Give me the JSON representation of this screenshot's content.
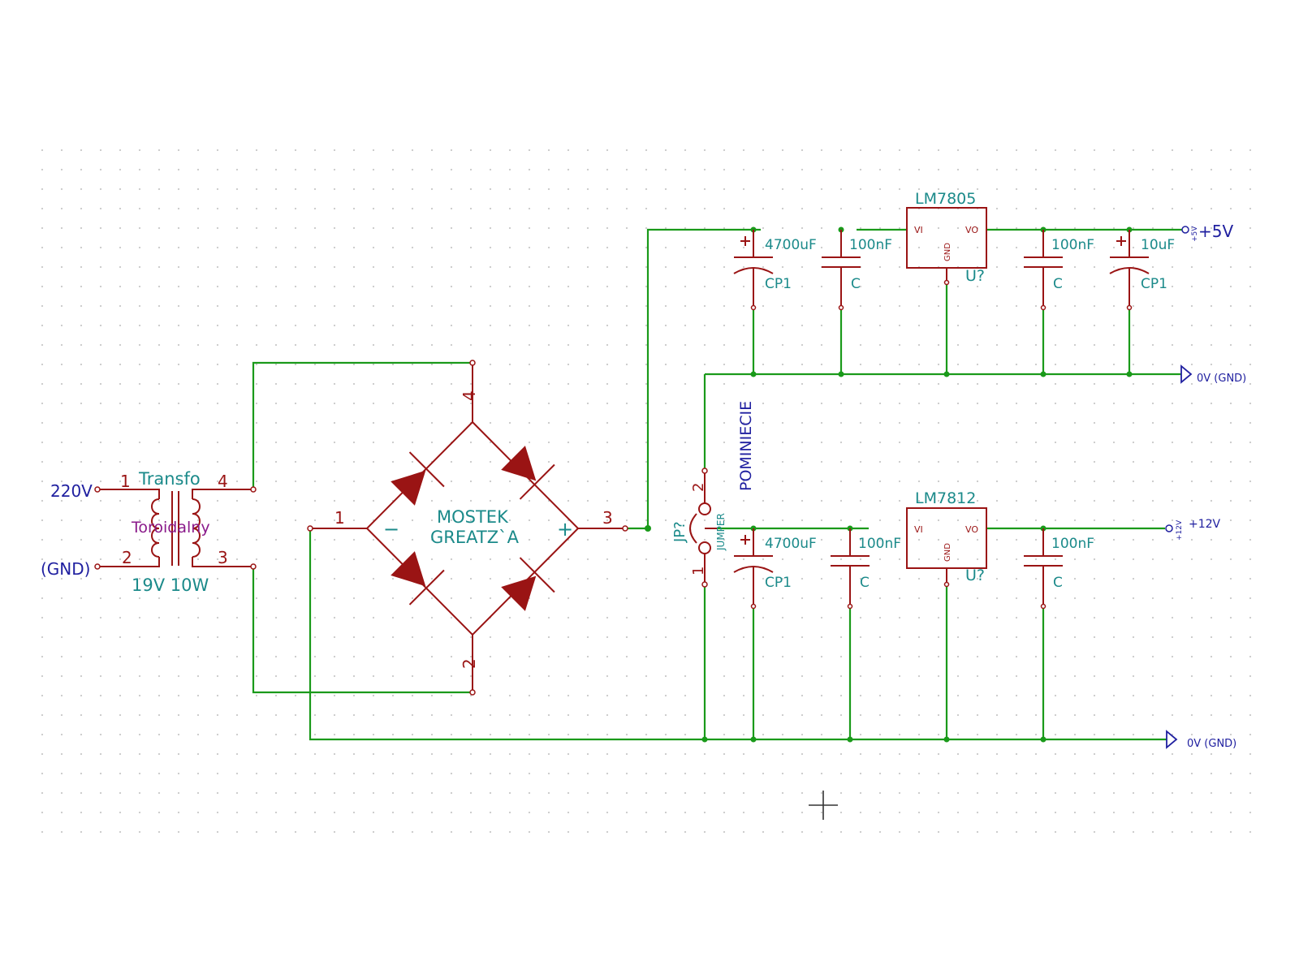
{
  "transformer": {
    "ref": "Transfo",
    "value": "Toroidalny",
    "rating": "19V 10W",
    "pins": [
      "1",
      "2",
      "3",
      "4"
    ]
  },
  "inputs": {
    "mains": "220V",
    "gnd": "(GND)"
  },
  "bridge": {
    "line1": "MOSTEK",
    "line2": "GREATZ`A",
    "minus": "−",
    "plus": "+",
    "pins": [
      "1",
      "2",
      "3",
      "4"
    ]
  },
  "reg5": {
    "name": "LM7805",
    "ref": "U?",
    "vi": "VI",
    "vo": "VO",
    "gnd": "GND"
  },
  "reg12": {
    "name": "LM7812",
    "ref": "U?",
    "vi": "VI",
    "vo": "VO",
    "gnd": "GND"
  },
  "caps": {
    "c5_in_big": {
      "value": "4700uF",
      "ref": "CP1"
    },
    "c5_in_small": {
      "value": "100nF",
      "ref": "C"
    },
    "c5_out_small": {
      "value": "100nF",
      "ref": "C"
    },
    "c5_out_big": {
      "value": "10uF",
      "ref": "CP1"
    },
    "c12_in_big": {
      "value": "4700uF",
      "ref": "CP1"
    },
    "c12_in_small": {
      "value": "100nF",
      "ref": "C"
    },
    "c12_out_small": {
      "value": "100nF",
      "ref": "C"
    }
  },
  "jumper": {
    "ref": "JP?",
    "value": "JUMPER",
    "pin1": "1",
    "pin2": "2",
    "label": "POMINIECIE"
  },
  "outputs": {
    "v5": "+5V",
    "v5_small": "+5V",
    "v12": "+12V",
    "gnd_top": "0V (GND)",
    "gnd_bottom": "0V (GND)"
  }
}
